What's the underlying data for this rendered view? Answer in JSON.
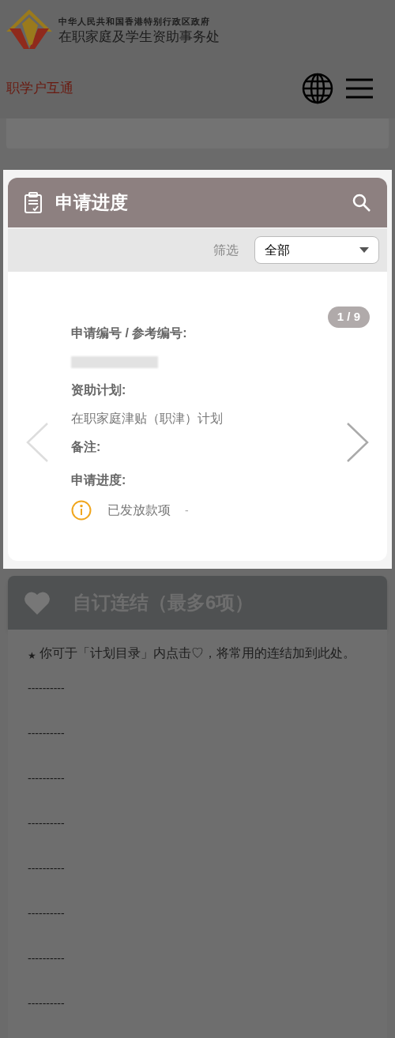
{
  "header": {
    "agency_line1": "中华人民共和国香港特别行政区政府",
    "agency_line2": "在职家庭及学生资助事务处",
    "portal_name": "职学户互通"
  },
  "progress_card": {
    "title": "申请进度",
    "filter_label": "筛选",
    "filter_value": "全部",
    "page_indicator": "1 / 9",
    "fields": [
      {
        "kind": "redacted",
        "label": "申请编号 / 参考编号:"
      },
      {
        "kind": "text",
        "label": "资助计划:",
        "value": "在职家庭津贴（职津）计划"
      },
      {
        "kind": "empty",
        "label": "备注:"
      },
      {
        "kind": "status",
        "label": "申请进度:",
        "value": "已发放款项",
        "suffix": "-"
      }
    ]
  },
  "favorites": {
    "title": "自订连结（最多6项）",
    "note_mark": "★",
    "note": "你可于「计划目录」内点击♡，将常用的连结加到此处。",
    "slots": [
      "----------",
      "----------",
      "----------",
      "----------",
      "----------",
      "----------",
      "----------",
      "----------"
    ]
  }
}
